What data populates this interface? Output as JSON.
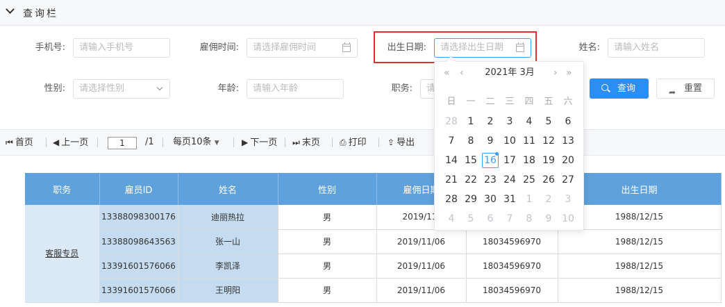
{
  "query_bar": {
    "title": "查询栏",
    "fields": {
      "phone": {
        "label": "手机号:",
        "placeholder": "请输入手机号"
      },
      "hire_time": {
        "label": "雇佣时间:",
        "placeholder": "请选择雇佣时间"
      },
      "birth_date": {
        "label": "出生日期:",
        "placeholder": "请选择出生日期"
      },
      "name": {
        "label": "姓名:",
        "placeholder": "请输入姓名"
      },
      "gender": {
        "label": "性别:",
        "placeholder": "请选择性别"
      },
      "age": {
        "label": "年龄:",
        "placeholder": "请输入年龄"
      },
      "position": {
        "label": "职务:",
        "placeholder": "请"
      }
    },
    "search_label": "查询",
    "reset_label": "重置"
  },
  "toolbar": {
    "first": "首页",
    "prev": "上一页",
    "page_value": "1",
    "total_pages": "/1",
    "per_page": "每页10条",
    "next": "下一页",
    "last": "末页",
    "print": "打印",
    "export": "导出"
  },
  "table": {
    "headers": [
      "职务",
      "雇员ID",
      "姓名",
      "性别",
      "雇佣日期",
      "",
      "出生日期"
    ],
    "group_position": "客服专员",
    "rows": [
      {
        "id": "13388098300176",
        "name": "迪丽热拉",
        "gender": "男",
        "hire": "2019/11/",
        "phone": "",
        "birth": "1988/12/15"
      },
      {
        "id": "13388098643563",
        "name": "张一山",
        "gender": "男",
        "hire": "2019/11/06",
        "phone": "18034596970",
        "birth": "1988/12/15"
      },
      {
        "id": "13391601576066",
        "name": "李凯泽",
        "gender": "男",
        "hire": "2019/11/06",
        "phone": "18034596970",
        "birth": "1988/12/15"
      },
      {
        "id": "13391601576066",
        "name": "王明阳",
        "gender": "男",
        "hire": "2019/11/06",
        "phone": "18034596970",
        "birth": "1988/12/15"
      }
    ]
  },
  "date_picker": {
    "title": "2021年 3月",
    "prev_year": "«",
    "prev_month": "‹",
    "next_month": "›",
    "next_year": "»",
    "weekdays": [
      "日",
      "一",
      "二",
      "三",
      "四",
      "五",
      "六"
    ],
    "weeks": [
      [
        "28",
        "1",
        "2",
        "3",
        "4",
        "5",
        "6"
      ],
      [
        "7",
        "8",
        "9",
        "10",
        "11",
        "12",
        "13"
      ],
      [
        "14",
        "15",
        "16",
        "17",
        "18",
        "19",
        "20"
      ],
      [
        "21",
        "22",
        "23",
        "24",
        "25",
        "26",
        "27"
      ],
      [
        "28",
        "29",
        "30",
        "31",
        "1",
        "2",
        "3"
      ],
      [
        "4",
        "5",
        "6",
        "7",
        "8",
        "9",
        "10"
      ]
    ],
    "selected_day": "16",
    "accent_color": "#409eff"
  }
}
